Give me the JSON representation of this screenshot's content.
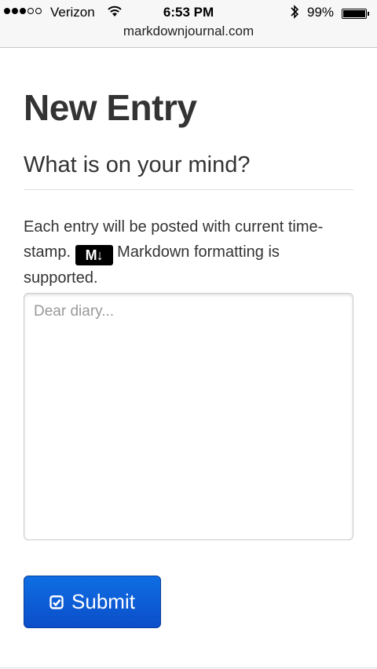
{
  "status_bar": {
    "carrier": "Verizon",
    "time": "6:53 PM",
    "battery_percent": "99%",
    "battery_level": 0.99,
    "signal_bars_full": 3,
    "signal_bars_total": 5
  },
  "browser": {
    "url": "markdownjournal.com"
  },
  "page": {
    "title": "New Entry",
    "subtitle": "What is on your mind?",
    "help_text_before": "Each entry will be posted with current time-stamp.",
    "markdown_badge": "M↓",
    "help_text_after": "Markdown formatting is supported.",
    "entry_placeholder": "Dear diary...",
    "entry_value": "",
    "submit_label": "Submit"
  },
  "colors": {
    "submit_bg": "#0b5fd6",
    "text": "#333333",
    "placeholder": "#999999"
  },
  "icons": {
    "submit_icon": "check-square-icon",
    "markdown_icon": "markdown-logo-icon"
  }
}
